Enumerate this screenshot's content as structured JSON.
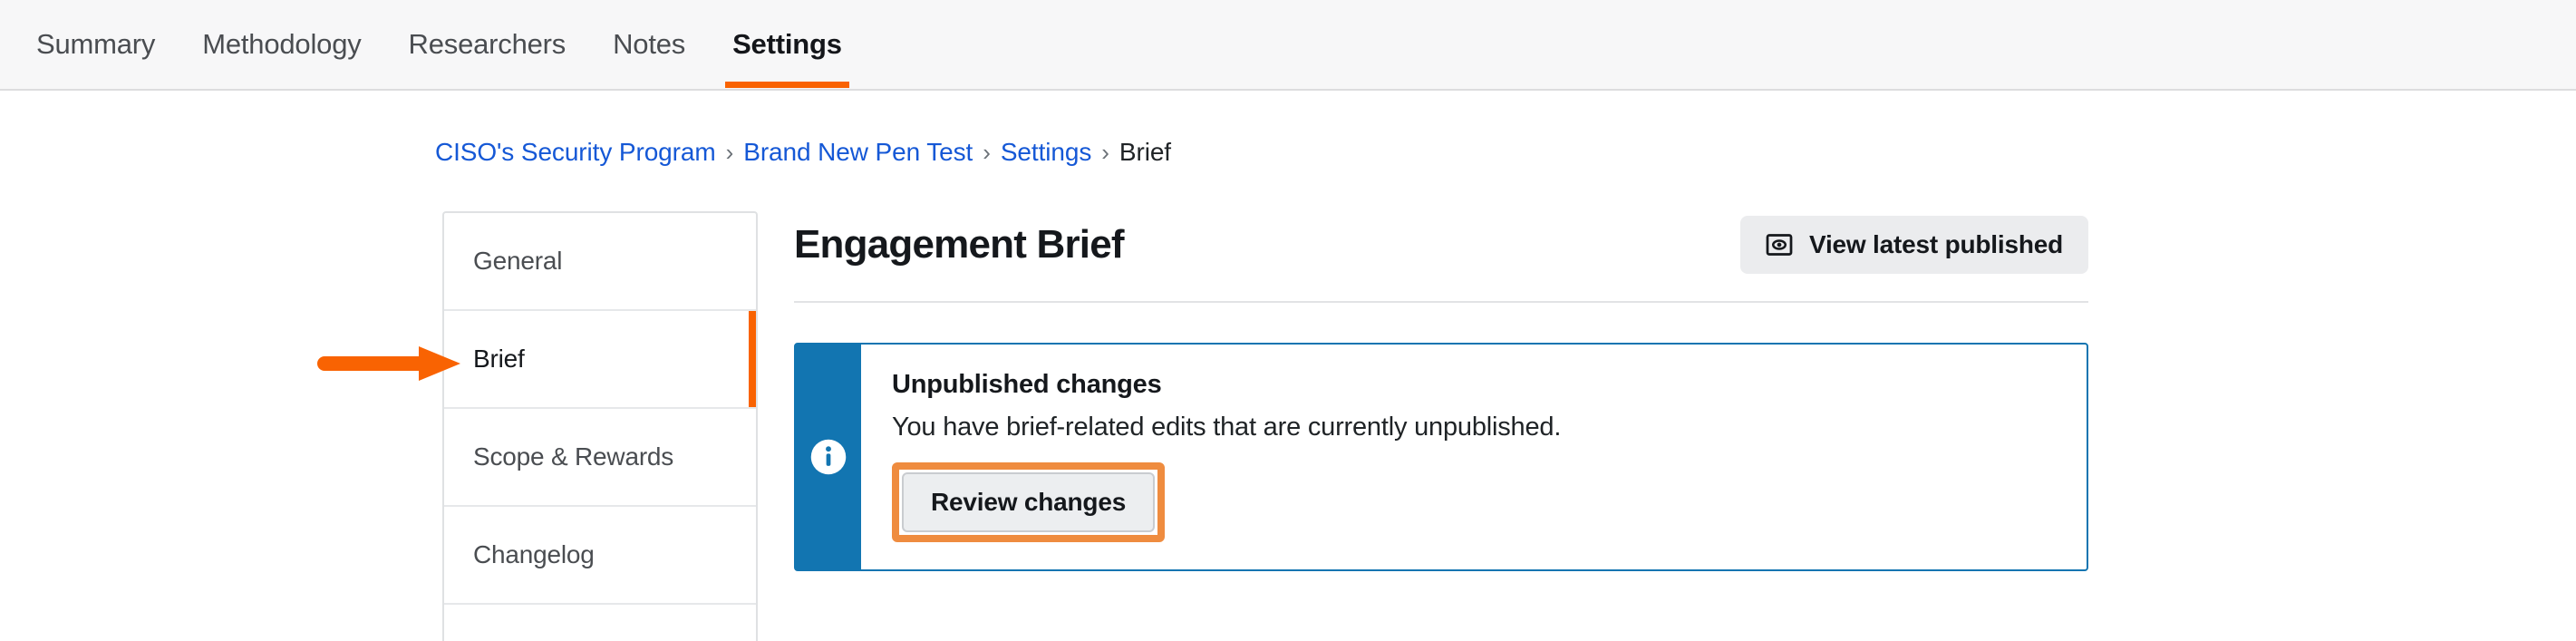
{
  "colors": {
    "accent_orange": "#f96302",
    "annotation_orange": "#f96302",
    "highlight_ring": "#ef8c3f",
    "link_blue": "#1558d6",
    "banner_blue": "#1275b1",
    "header_bg": "#f7f7f8"
  },
  "topnav": {
    "tabs": [
      {
        "label": "Summary",
        "active": false
      },
      {
        "label": "Methodology",
        "active": false
      },
      {
        "label": "Researchers",
        "active": false
      },
      {
        "label": "Notes",
        "active": false
      },
      {
        "label": "Settings",
        "active": true
      }
    ]
  },
  "breadcrumb": {
    "separator": "›",
    "items": [
      {
        "label": "CISO's Security Program",
        "link": true
      },
      {
        "label": "Brand New Pen Test",
        "link": true
      },
      {
        "label": "Settings",
        "link": true
      },
      {
        "label": "Brief",
        "link": false
      }
    ]
  },
  "sidebar": {
    "items": [
      {
        "label": "General",
        "active": false
      },
      {
        "label": "Brief",
        "active": true
      },
      {
        "label": "Scope & Rewards",
        "active": false
      },
      {
        "label": "Changelog",
        "active": false
      },
      {
        "label": "",
        "active": false
      }
    ]
  },
  "main": {
    "title": "Engagement Brief",
    "view_published_label": "View latest published",
    "view_published_icon": "eye-preview-icon"
  },
  "banner": {
    "icon": "info-circle-icon",
    "title": "Unpublished changes",
    "text": "You have brief-related edits that are currently unpublished.",
    "button_label": "Review changes"
  },
  "annotations": {
    "arrow": {
      "icon": "arrow-right-annotation",
      "points_to": "sidebar-item-brief",
      "color": "#f96302"
    }
  }
}
